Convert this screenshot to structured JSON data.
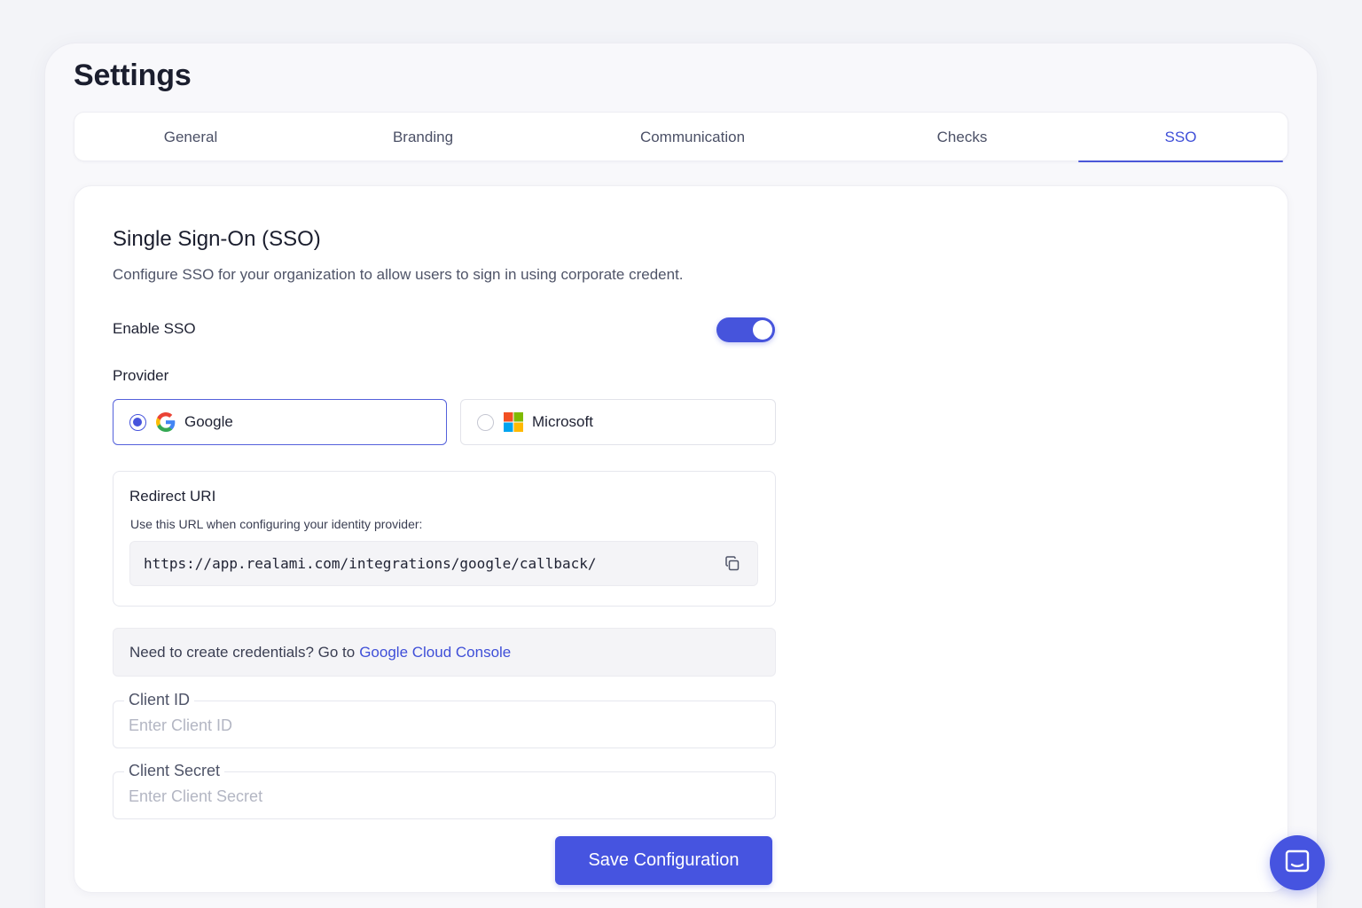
{
  "page": {
    "title": "Settings"
  },
  "tabs": [
    {
      "label": "General"
    },
    {
      "label": "Branding"
    },
    {
      "label": "Communication"
    },
    {
      "label": "Checks"
    },
    {
      "label": "SSO"
    }
  ],
  "active_tab": "SSO",
  "sso": {
    "title": "Single Sign-On (SSO)",
    "description": "Configure SSO for your organization to allow users to sign in using corporate credent.",
    "enable_label": "Enable SSO",
    "enabled": true,
    "provider_label": "Provider",
    "providers": [
      {
        "name": "Google",
        "icon": "google-logo-icon",
        "selected": true
      },
      {
        "name": "Microsoft",
        "icon": "microsoft-logo-icon",
        "selected": false
      }
    ],
    "redirect": {
      "title": "Redirect URI",
      "help": "Use this URL when configuring your identity provider:",
      "uri": "https://app.realami.com/integrations/google/callback/",
      "copy_icon": "copy-icon"
    },
    "credentials_hint": {
      "text": "Need to create credentials? Go to",
      "link": "Google Cloud Console"
    },
    "client_id": {
      "label": "Client ID",
      "placeholder": "Enter Client ID",
      "value": ""
    },
    "client_secret": {
      "label": "Client Secret",
      "placeholder": "Enter Client Secret",
      "value": ""
    },
    "save_label": "Save Configuration"
  },
  "colors": {
    "accent": "#4654dc",
    "link": "#3f4fd8",
    "background": "#f3f4f8"
  },
  "chat": {
    "icon": "chat-bubble-icon"
  }
}
